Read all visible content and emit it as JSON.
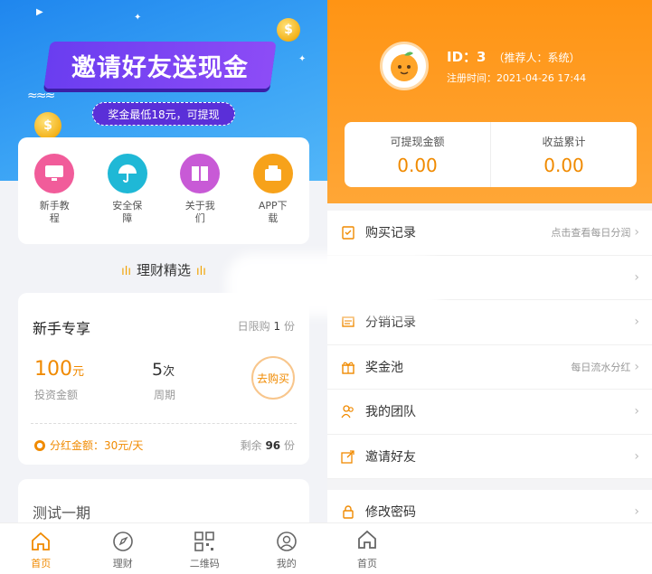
{
  "colors": {
    "accent": "#f08a00",
    "left_banner": "#2a8ff0",
    "right_header": "#ff9a1f",
    "invite_purple": "#6a3df0"
  },
  "left": {
    "banner": {
      "title": "邀请好友送现金",
      "subtitle": "奖金最低18元，可提现",
      "coin_symbol": "$"
    },
    "quick_links": [
      {
        "label": "新手教程",
        "icon": "monitor-icon",
        "color": "#f15c9a"
      },
      {
        "label": "安全保障",
        "icon": "umbrella-icon",
        "color": "#1fb8d6"
      },
      {
        "label": "关于我们",
        "icon": "book-icon",
        "color": "#c85ad6"
      },
      {
        "label": "APP下载",
        "icon": "box-icon",
        "color": "#f7a21a"
      }
    ],
    "section_title": "理财精选",
    "product": {
      "title": "新手专享",
      "limit_prefix": "日限购",
      "limit_value": "1",
      "limit_unit": "份",
      "amount": "100",
      "amount_unit": "元",
      "amount_label": "投资金额",
      "period": "5",
      "period_unit": "次",
      "period_label": "周期",
      "buy_label": "去购买",
      "bonus": "分红金额：30元/天",
      "remain_prefix": "剩余",
      "remain_value": "96",
      "remain_unit": "份"
    },
    "product2": {
      "title": "测试一期"
    },
    "tabs": [
      {
        "label": "首页",
        "icon": "home-icon",
        "active": true
      },
      {
        "label": "理财",
        "icon": "compass-icon",
        "active": false
      },
      {
        "label": "二维码",
        "icon": "qrcode-icon",
        "active": false
      },
      {
        "label": "我的",
        "icon": "user-icon",
        "active": false
      }
    ]
  },
  "right": {
    "user": {
      "id_label": "ID：3",
      "referrer": "（推荐人：系统）",
      "register_time": "注册时间：2021-04-26 17:44"
    },
    "balance": [
      {
        "label": "可提现金额",
        "value": "0.00"
      },
      {
        "label": "收益累计",
        "value": "0.00"
      }
    ],
    "menu": [
      {
        "label": "购买记录",
        "hint": "点击查看每日分润",
        "icon": "clipboard-icon"
      },
      {
        "label": "",
        "hint": "",
        "icon": ""
      },
      {
        "label": "分销记录",
        "hint": "",
        "icon": "list-icon"
      },
      {
        "label": "奖金池",
        "hint": "每日流水分红",
        "icon": "gift-icon"
      },
      {
        "label": "我的团队",
        "hint": "",
        "icon": "team-icon"
      },
      {
        "label": "邀请好友",
        "hint": "",
        "icon": "share-icon"
      }
    ],
    "menu2": [
      {
        "label": "修改密码",
        "hint": "",
        "icon": "lock-icon"
      }
    ],
    "tab": {
      "label": "首页",
      "icon": "home-icon"
    }
  }
}
